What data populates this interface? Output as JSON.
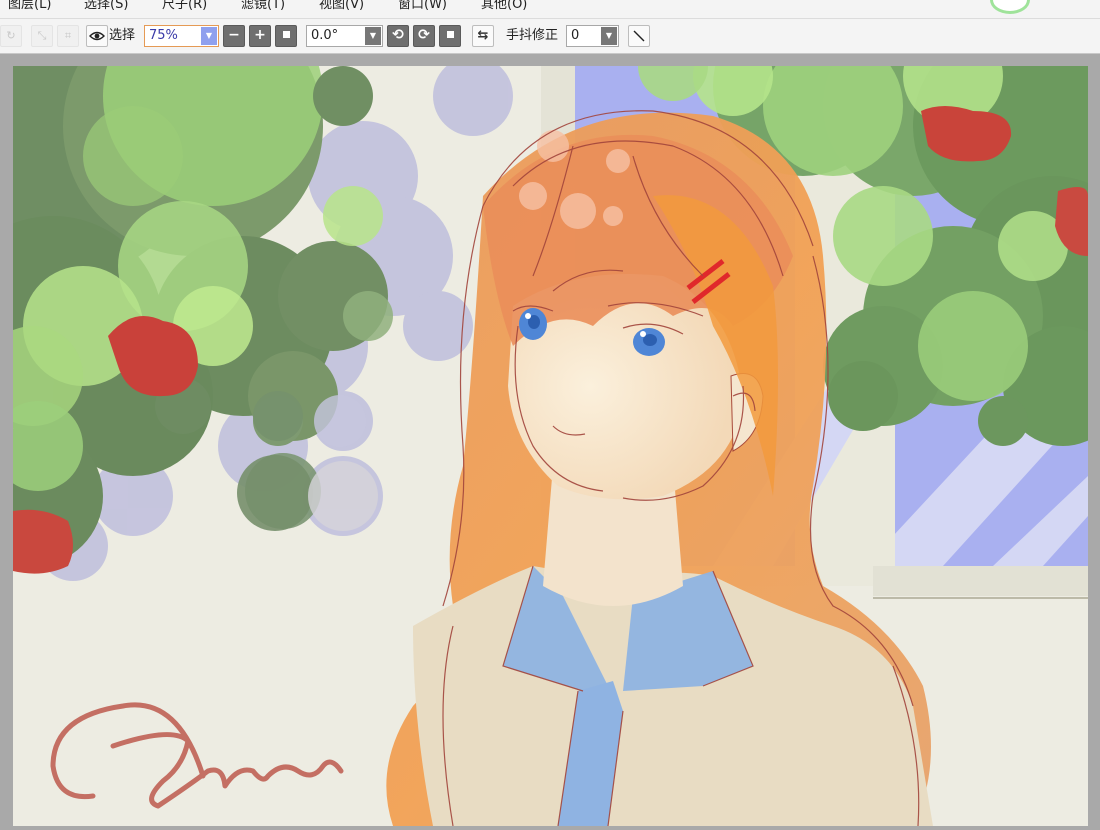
{
  "menu": {
    "items": [
      {
        "label": "图层(L)"
      },
      {
        "label": "选择(S)"
      },
      {
        "label": "尺子(R)"
      },
      {
        "label": "滤镜(T)"
      },
      {
        "label": "视图(V)"
      },
      {
        "label": "窗口(W)"
      },
      {
        "label": "其他(O)"
      }
    ]
  },
  "toolbar": {
    "select_label": "选择",
    "zoom_value": "75%",
    "rotation_value": "0.0°",
    "stabilizer_label": "手抖修正",
    "stabilizer_value": "0"
  },
  "icons": {
    "eye": "eye-icon",
    "zoom_out": "minus-icon",
    "zoom_in": "plus-icon",
    "zoom_reset": "square-icon",
    "rotate_left": "rotate-left-icon",
    "rotate_right": "rotate-right-icon",
    "rotate_reset": "square-icon",
    "flip": "flip-horizontal-icon",
    "line": "line-tool-icon"
  },
  "colors": {
    "accent": "#e59a55",
    "dropdown_active": "#8fa0ee",
    "canvas_bg": "#a9a9a9"
  }
}
